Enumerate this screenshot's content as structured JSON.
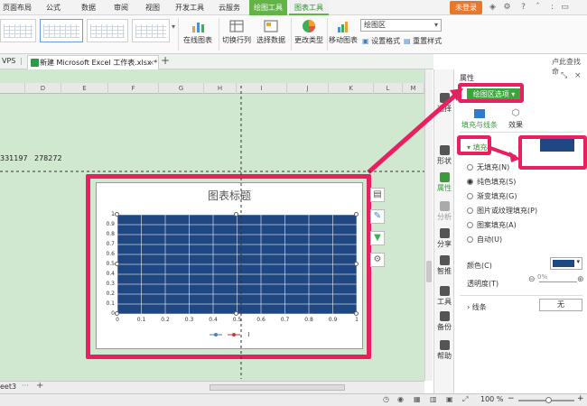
{
  "ribbon": {
    "tabs": [
      "页面布局",
      "公式",
      "数据",
      "审阅",
      "视图",
      "开发工具",
      "云服务",
      "绘图工具",
      "图表工具"
    ],
    "active_tab": "图表工具",
    "login_label": "未登录",
    "buttons": {
      "online_chart": "在线图表",
      "switch_rowcol": "切换行列",
      "select_data": "选择数据",
      "change_type": "更改类型",
      "move_chart": "移动图表",
      "set_format": "设置格式",
      "reset_style": "重置样式"
    },
    "element_select_value": "绘图区"
  },
  "doc_tabs": {
    "left_partial": "VPS",
    "active_file": "新建 Microsoft Excel 工作表.xlsx *",
    "close_glyph": "×",
    "add_glyph": "+"
  },
  "sheet": {
    "columns": [
      "D",
      "E",
      "F",
      "G",
      "H",
      "I",
      "J",
      "K",
      "L",
      "M"
    ],
    "cell_values": [
      "331197",
      "278272"
    ],
    "sheet_tab_partial": "eet3",
    "add_sheet_glyph": "+",
    "more_glyph": "···"
  },
  "chart": {
    "title": "图表标题",
    "legend_label": "I"
  },
  "chart_data": {
    "type": "scatter",
    "title": "图表标题",
    "xlabel": "",
    "ylabel": "",
    "x_ticks": [
      "0",
      "0.1",
      "0.2",
      "0.3",
      "0.4",
      "0.5",
      "0.6",
      "0.7",
      "0.8",
      "0.9",
      "1"
    ],
    "y_ticks": [
      "0",
      "0.1",
      "0.2",
      "0.3",
      "0.4",
      "0.5",
      "0.6",
      "0.7",
      "0.8",
      "0.9",
      "1"
    ],
    "xlim": [
      0,
      1
    ],
    "ylim": [
      0,
      1
    ],
    "grid": true,
    "plot_area_fill": "#1f4781",
    "series": [
      {
        "name": "",
        "color": "#4a7cc7",
        "values": []
      },
      {
        "name": "I",
        "color": "#c0392b",
        "values": []
      }
    ]
  },
  "status": {
    "zoom": "100 %",
    "zoom_minus": "−",
    "zoom_plus": "+"
  },
  "side_panel": {
    "header": "属性",
    "header_right": "卢此查找命",
    "selector": "绘图区选项",
    "subtabs": [
      "填充与线条",
      "效果"
    ],
    "fill_section": "填充",
    "fill_options": [
      "无填充(N)",
      "纯色填充(S)",
      "渐变填充(G)",
      "图片或纹理填充(P)",
      "图案填充(A)",
      "自动(U)"
    ],
    "selected_option": "纯色填充(S)",
    "color_label": "颜色(C)",
    "transparency_label": "透明度(T)",
    "transparency_value": "0%",
    "line_section": "线条",
    "line_value": "无",
    "fill_color": "#1f4781"
  },
  "vertical_tools": [
    "选择",
    "形状",
    "属性",
    "分析",
    "分享",
    "智推",
    "工具",
    "备份",
    "帮助"
  ]
}
